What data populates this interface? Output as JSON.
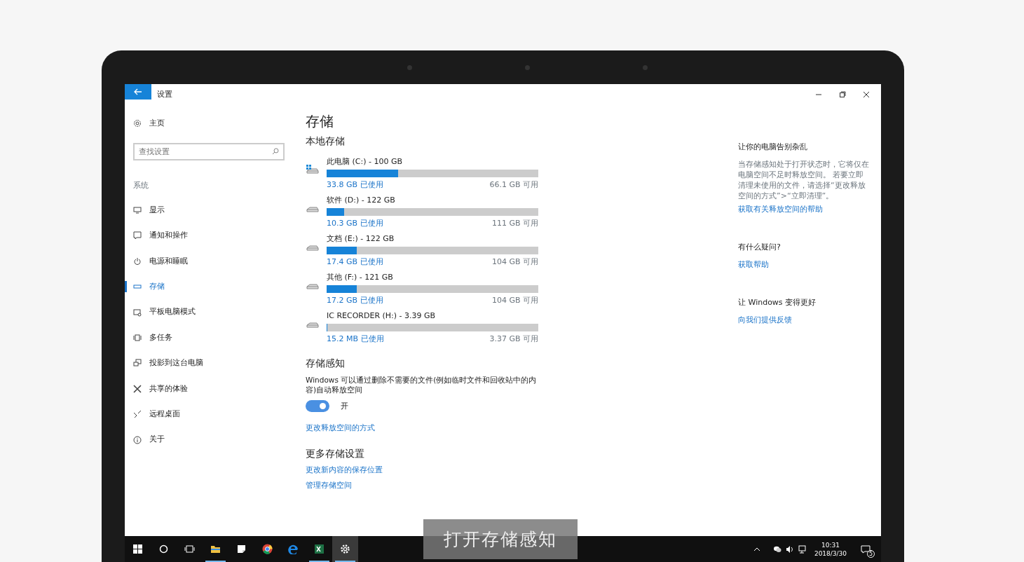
{
  "window": {
    "title": "设置"
  },
  "sidebar": {
    "home": "主页",
    "search": {
      "placeholder": "查找设置"
    },
    "group": "系统",
    "items": [
      {
        "kind": "display",
        "label": "显示",
        "selected": false
      },
      {
        "kind": "notify",
        "label": "通知和操作",
        "selected": false
      },
      {
        "kind": "power",
        "label": "电源和睡眠",
        "selected": false
      },
      {
        "kind": "storage",
        "label": "存储",
        "selected": true
      },
      {
        "kind": "tablet",
        "label": "平板电脑模式",
        "selected": false
      },
      {
        "kind": "multitask",
        "label": "多任务",
        "selected": false
      },
      {
        "kind": "project",
        "label": "投影到这台电脑",
        "selected": false
      },
      {
        "kind": "share",
        "label": "共享的体验",
        "selected": false
      },
      {
        "kind": "remote",
        "label": "远程桌面",
        "selected": false
      },
      {
        "kind": "about",
        "label": "关于",
        "selected": false
      }
    ]
  },
  "page": {
    "title": "存储",
    "local_heading": "本地存储",
    "drives": [
      {
        "name": "此电脑 (C:) - 100 GB",
        "system": true,
        "level": 0.338,
        "used": "33.8 GB 已使用",
        "free": "66.1 GB 可用"
      },
      {
        "name": "软件 (D:) - 122 GB",
        "system": false,
        "level": 0.084,
        "used": "10.3 GB 已使用",
        "free": "111 GB 可用"
      },
      {
        "name": "文档 (E:) - 122 GB",
        "system": false,
        "level": 0.143,
        "used": "17.4 GB 已使用",
        "free": "104 GB 可用"
      },
      {
        "name": "其他 (F:) - 121 GB",
        "system": false,
        "level": 0.142,
        "used": "17.2 GB 已使用",
        "free": "104 GB 可用"
      },
      {
        "name": "IC RECORDER (H:) - 3.39 GB",
        "system": false,
        "level": 0.004,
        "used": "15.2 MB 已使用",
        "free": "3.37 GB 可用"
      }
    ],
    "sense": {
      "heading": "存储感知",
      "description": "Windows 可以通过删除不需要的文件(例如临时文件和回收站中的内容)自动释放空间",
      "on": true,
      "state_label": "开",
      "link": "更改释放空间的方式"
    },
    "more": {
      "heading": "更多存储设置",
      "links": [
        "更改新内容的保存位置",
        "管理存储空间"
      ]
    }
  },
  "aside": [
    {
      "heading": "让你的电脑告别杂乱",
      "text": "当存储感知处于打开状态时，它将仅在电脑空间不足时释放空间。 若要立即清理未使用的文件，请选择“更改释放空间的方式”>“立即清理”。",
      "link": "获取有关释放空间的帮助"
    },
    {
      "heading": "有什么疑问?",
      "link": "获取帮助"
    },
    {
      "heading": "让 Windows 变得更好",
      "link": "向我们提供反馈"
    }
  ],
  "taskbar": {
    "items": [
      {
        "kind": "start",
        "running": false,
        "selected": false
      },
      {
        "kind": "search",
        "running": false,
        "selected": false
      },
      {
        "kind": "taskview",
        "running": false,
        "selected": false
      },
      {
        "kind": "explorer",
        "running": true,
        "selected": false
      },
      {
        "kind": "notes",
        "running": false,
        "selected": false
      },
      {
        "kind": "chrome",
        "running": false,
        "selected": false
      },
      {
        "kind": "edge",
        "running": false,
        "selected": false
      },
      {
        "kind": "excel",
        "running": true,
        "selected": false
      },
      {
        "kind": "settings",
        "running": true,
        "selected": true
      }
    ],
    "time": "10:31",
    "date": "2018/3/30",
    "notifications": "5"
  },
  "subtitle": "打开存储感知"
}
